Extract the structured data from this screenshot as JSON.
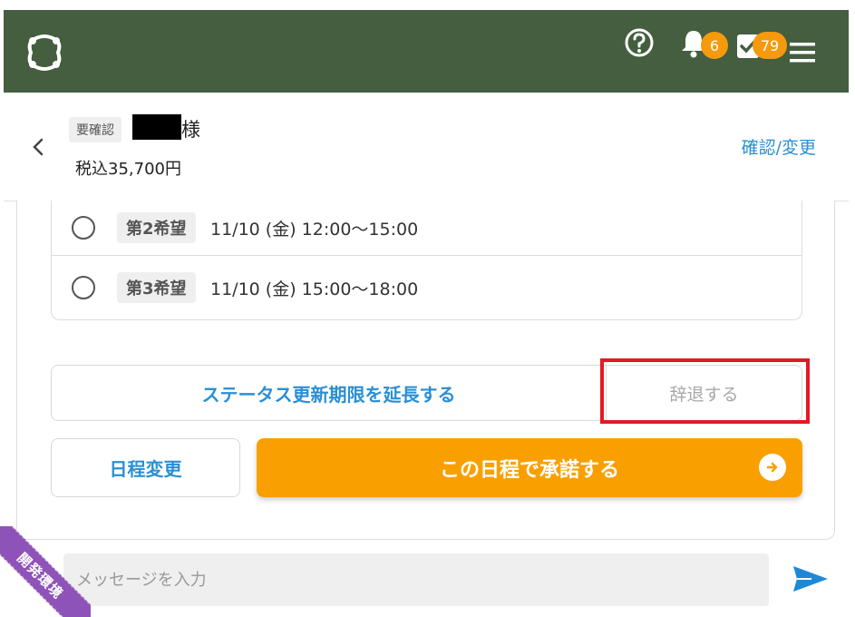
{
  "header": {
    "notification_count": "6",
    "task_count": "79",
    "icons": [
      "logo-icon",
      "help-icon",
      "bell-icon",
      "task-check-icon",
      "menu-icon"
    ],
    "colors": {
      "bar": "#445e3f",
      "badge": "#f59a0c"
    }
  },
  "customer": {
    "status_tag": "要確認",
    "name_suffix": "様",
    "price": "税込35,700円",
    "confirm_link": "確認/変更"
  },
  "options": [
    {
      "label": "第2希望",
      "time": "11/10 (金) 12:00～15:00"
    },
    {
      "label": "第3希望",
      "time": "11/10 (金) 15:00～18:00"
    }
  ],
  "actions": {
    "extend": "ステータス更新期限を延長する",
    "decline": "辞退する",
    "reschedule": "日程変更",
    "accept": "この日程で承諾する"
  },
  "message": {
    "placeholder": "メッセージを入力"
  },
  "dev_ribbon": "開発環境",
  "accent_colors": {
    "link": "#2b8fd3",
    "accept": "#f9a000",
    "highlight": "#e01b24",
    "ribbon": "#8e53b8"
  }
}
